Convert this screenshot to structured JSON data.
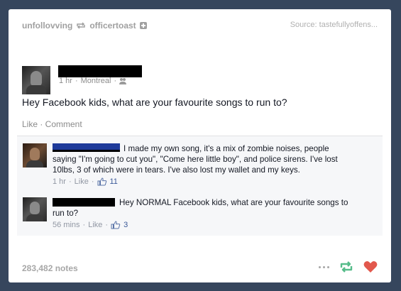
{
  "header": {
    "reblogger": "unfollovving",
    "original_poster": "officertoast",
    "source": "Source: tastefullyoffens..."
  },
  "post": {
    "time": "1 hr",
    "location": "Montreal",
    "text": "Hey Facebook kids, what are your favourite songs to run to?",
    "actions": "Like · Comment"
  },
  "comments": [
    {
      "text_lines": [
        "I made my own song, it's a mix of zombie noises, people",
        "saying \"I'm going to cut you\", \"Come here little boy\", and police sirens. I've lost",
        "10lbs, 3 of which were in tears. I've also lost my wallet and my keys."
      ],
      "time": "1 hr",
      "like_label": "Like",
      "likes": "11"
    },
    {
      "text_lines": [
        "Hey NORMAL Facebook kids, what are your favourite songs to",
        "run to?"
      ],
      "time": "56 mins",
      "like_label": "Like",
      "likes": "3"
    }
  ],
  "footer": {
    "notes": "283,482 notes"
  },
  "colors": {
    "background": "#36465d",
    "reblog_green": "#56bc8a",
    "heart_red": "#e2584d"
  }
}
